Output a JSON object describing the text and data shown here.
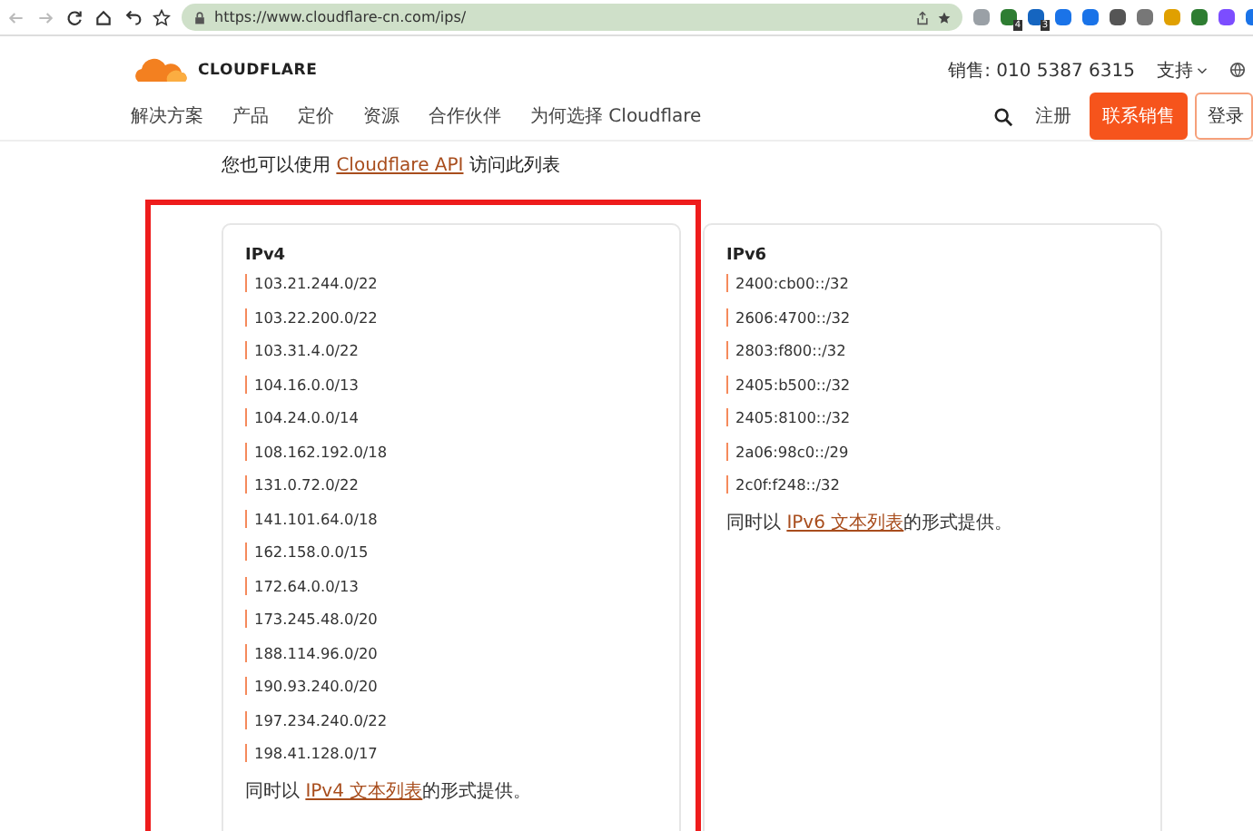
{
  "browser": {
    "url": "https://www.cloudflare-cn.com/ips/",
    "extension_badges": [
      "4",
      "3"
    ]
  },
  "header": {
    "logo": "CLOUDFLARE",
    "phone": "销售: 010 5387 6315",
    "support": "支持",
    "nav": [
      "解决方案",
      "产品",
      "定价",
      "资源",
      "合作伙伴",
      "为何选择 Cloudflare"
    ],
    "signup": "注册",
    "contact": "联系销售",
    "login": "登录"
  },
  "intro": {
    "before": "您也可以使用",
    "link": "Cloudflare API",
    "after": "访问此列表"
  },
  "cards": [
    {
      "title": "IPv4",
      "highlighted": true,
      "ranges": [
        "103.21.244.0/22",
        "103.22.200.0/22",
        "103.31.4.0/22",
        "104.16.0.0/13",
        "104.24.0.0/14",
        "108.162.192.0/18",
        "131.0.72.0/22",
        "141.101.64.0/18",
        "162.158.0.0/15",
        "172.64.0.0/13",
        "173.245.48.0/20",
        "188.114.96.0/20",
        "190.93.240.0/20",
        "197.234.240.0/22",
        "198.41.128.0/17"
      ],
      "note_before": "同时以",
      "note_link": "IPv4 文本列表",
      "note_after": "的形式提供。"
    },
    {
      "title": "IPv6",
      "highlighted": false,
      "ranges": [
        "2400:cb00::/32",
        "2606:4700::/32",
        "2803:f800::/32",
        "2405:b500::/32",
        "2405:8100::/32",
        "2a06:98c0::/29",
        "2c0f:f248::/32"
      ],
      "note_before": "同时以",
      "note_link": "IPv6 文本列表",
      "note_after": "的形式提供。"
    }
  ]
}
